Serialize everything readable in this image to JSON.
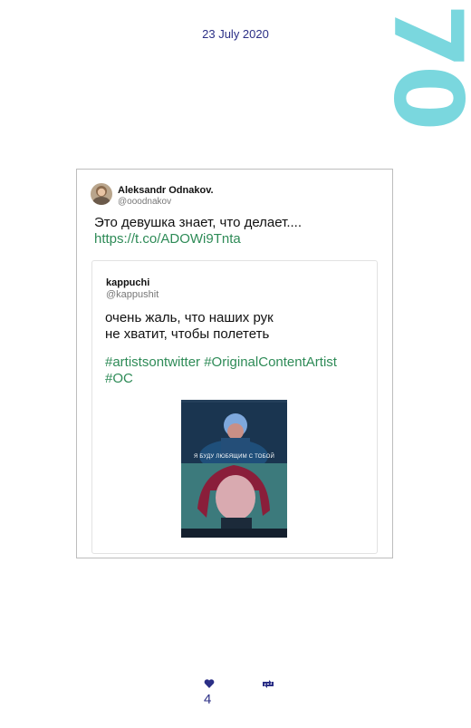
{
  "header": {
    "date": "23 July 2020",
    "page_number": "70"
  },
  "tweet": {
    "author_name": "Aleksandr Odnakov.",
    "author_handle": "@ooodnakov",
    "text": "Это девушка знает, что делает....",
    "link": "https://t.co/ADOWi9Tnta",
    "quote": {
      "author_name": "kappuchi",
      "author_handle": "@kappushit",
      "text_line1": "очень жаль, что наших рук",
      "text_line2": "не хватит, чтобы полететь",
      "hashtags_line1": "#artistsontwitter #OriginalContentArtist",
      "hashtags_line2": "#OC",
      "image_caption": "Я БУДУ ЛЮБЯЩИМ С ТОБОЙ"
    }
  },
  "footer": {
    "like_count": "4",
    "icons": [
      "heart-icon",
      "retweet-icon"
    ]
  },
  "colors": {
    "accent_navy": "#2b2f86",
    "page_number": "#7ad7de",
    "link_green": "#2e8b57"
  }
}
